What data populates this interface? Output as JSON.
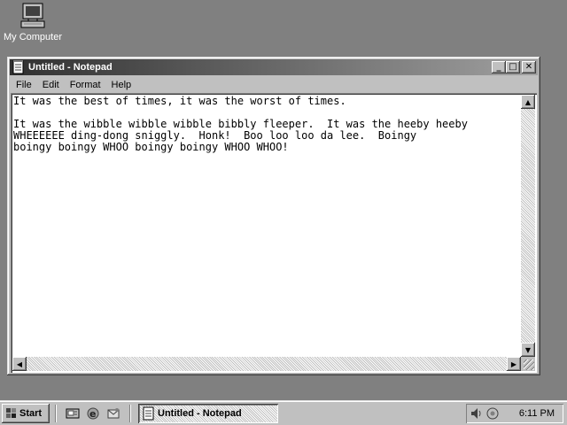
{
  "desktop": {
    "icons": [
      {
        "label": "My Computer",
        "icon": "computer-icon"
      }
    ]
  },
  "window": {
    "title": "Untitled - Notepad",
    "icon": "notepad-icon",
    "controls": {
      "minimize": "_",
      "maximize": "□",
      "close": "✕"
    },
    "menu": [
      "File",
      "Edit",
      "Format",
      "Help"
    ],
    "content": "It was the best of times, it was the worst of times.\n\nIt was the wibble wibble wibble bibbly fleeper.  It was the heeby heeby\nWHEEEEEE ding-dong sniggly.  Honk!  Boo loo loo da lee.  Boingy\nboingy boingy WHOO boingy boingy WHOO WHOO!",
    "scroll": {
      "up": "▲",
      "down": "▼",
      "left": "◀",
      "right": "▶"
    }
  },
  "taskbar": {
    "start_label": "Start",
    "quick_launch": [
      "show-desktop-icon",
      "internet-explorer-icon",
      "outlook-express-icon"
    ],
    "task_button": "Untitled - Notepad",
    "tray": [
      "volume-icon",
      "network-icon"
    ],
    "clock": "6:11 PM"
  },
  "colors": {
    "desktop": "#808080",
    "face": "#c0c0c0",
    "title_start": "#303030",
    "title_end": "#a0a0a0"
  }
}
